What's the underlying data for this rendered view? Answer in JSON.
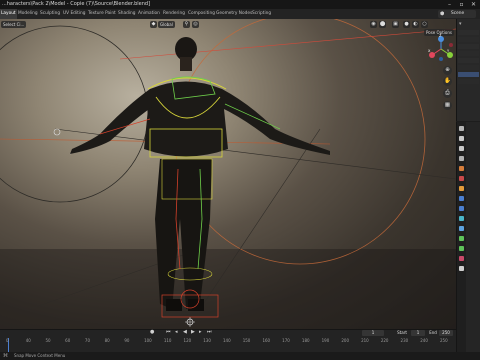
{
  "window": {
    "title": "...haracters\\Pack 2\\Model - Copie (7)\\Source\\Blender.blend]"
  },
  "workspace_tabs": [
    {
      "label": "Layout",
      "active": true
    },
    {
      "label": "Modeling",
      "active": false
    },
    {
      "label": "Sculpting",
      "active": false
    },
    {
      "label": "UV Editing",
      "active": false
    },
    {
      "label": "Texture Paint",
      "active": false
    },
    {
      "label": "Shading",
      "active": false
    },
    {
      "label": "Animation",
      "active": false
    },
    {
      "label": "Rendering",
      "active": false
    },
    {
      "label": "Compositing",
      "active": false
    },
    {
      "label": "Geometry Nodes",
      "active": false
    },
    {
      "label": "Scripting",
      "active": false
    }
  ],
  "scene": {
    "label": "Scene"
  },
  "viewport": {
    "select_mode": "Select Ci...",
    "orientation": "Global",
    "pose_options": "Pose Options",
    "gizmo_axes": [
      {
        "label": "Y",
        "color": "#88d13a"
      },
      {
        "label": "X",
        "color": "#e2475c"
      },
      {
        "label": "Z",
        "color": "#4a8fe0"
      }
    ],
    "nav_icons": [
      "zoom-icon",
      "hand-icon",
      "camera-icon",
      "grid-icon"
    ]
  },
  "timeline": {
    "ticks": [
      "0",
      "40",
      "50",
      "60",
      "70",
      "80",
      "90",
      "100",
      "110",
      "120",
      "130",
      "140",
      "150",
      "160",
      "170",
      "180",
      "190",
      "200",
      "210",
      "220",
      "230",
      "240",
      "250"
    ],
    "current_frame": "1",
    "start_label": "Start",
    "start_value": "1",
    "end_label": "End",
    "end_value": "250"
  },
  "status": {
    "text": "Snap Move Context Menu",
    "version": ""
  },
  "colors": {
    "armature_yellow": "#d8d63a",
    "armature_red": "#d2402a",
    "armature_green": "#6fd04a",
    "accent_blue": "#4b7fd0"
  }
}
